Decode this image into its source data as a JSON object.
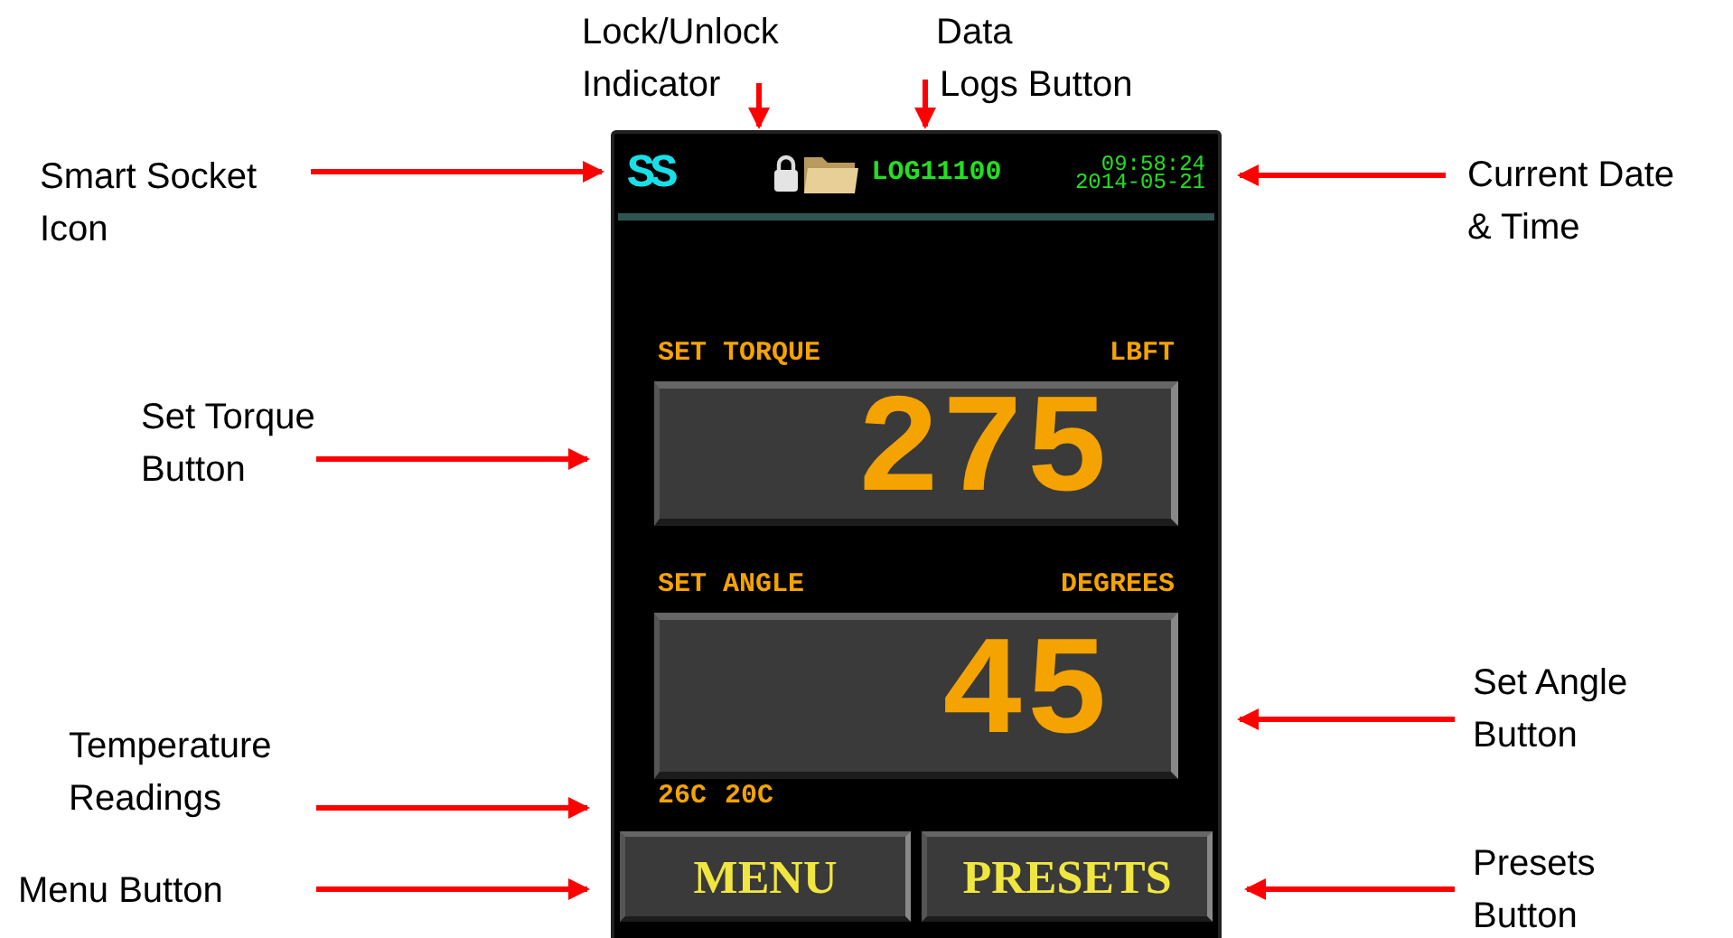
{
  "annotations": [
    {
      "lines": [
        "Lock/Unlock",
        "Indicator"
      ]
    },
    {
      "lines": [
        "Data",
        "Logs Button"
      ]
    },
    {
      "lines": [
        "Smart Socket",
        "Icon"
      ]
    },
    {
      "lines": [
        "Current Date",
        "& Time"
      ]
    },
    {
      "lines": [
        "Set Torque",
        "Button"
      ]
    },
    {
      "lines": [
        "Set Angle",
        "Button"
      ]
    },
    {
      "lines": [
        "Temperature",
        "Readings"
      ]
    },
    {
      "lines": [
        "Menu Button"
      ]
    },
    {
      "lines": [
        "Presets",
        "Button"
      ]
    }
  ],
  "device": {
    "header": {
      "app_icon": "SS",
      "locked": true,
      "log_button": "LOG11100",
      "time": "09:58:24",
      "date": "2014-05-21"
    },
    "fields": [
      {
        "label": "SET TORQUE",
        "unit": "LBFT",
        "value": "275"
      },
      {
        "label": "SET ANGLE",
        "unit": "DEGREES",
        "value": "45"
      }
    ],
    "temperatures": [
      "26C",
      "20C"
    ],
    "buttons": [
      "MENU",
      "PRESETS"
    ]
  }
}
